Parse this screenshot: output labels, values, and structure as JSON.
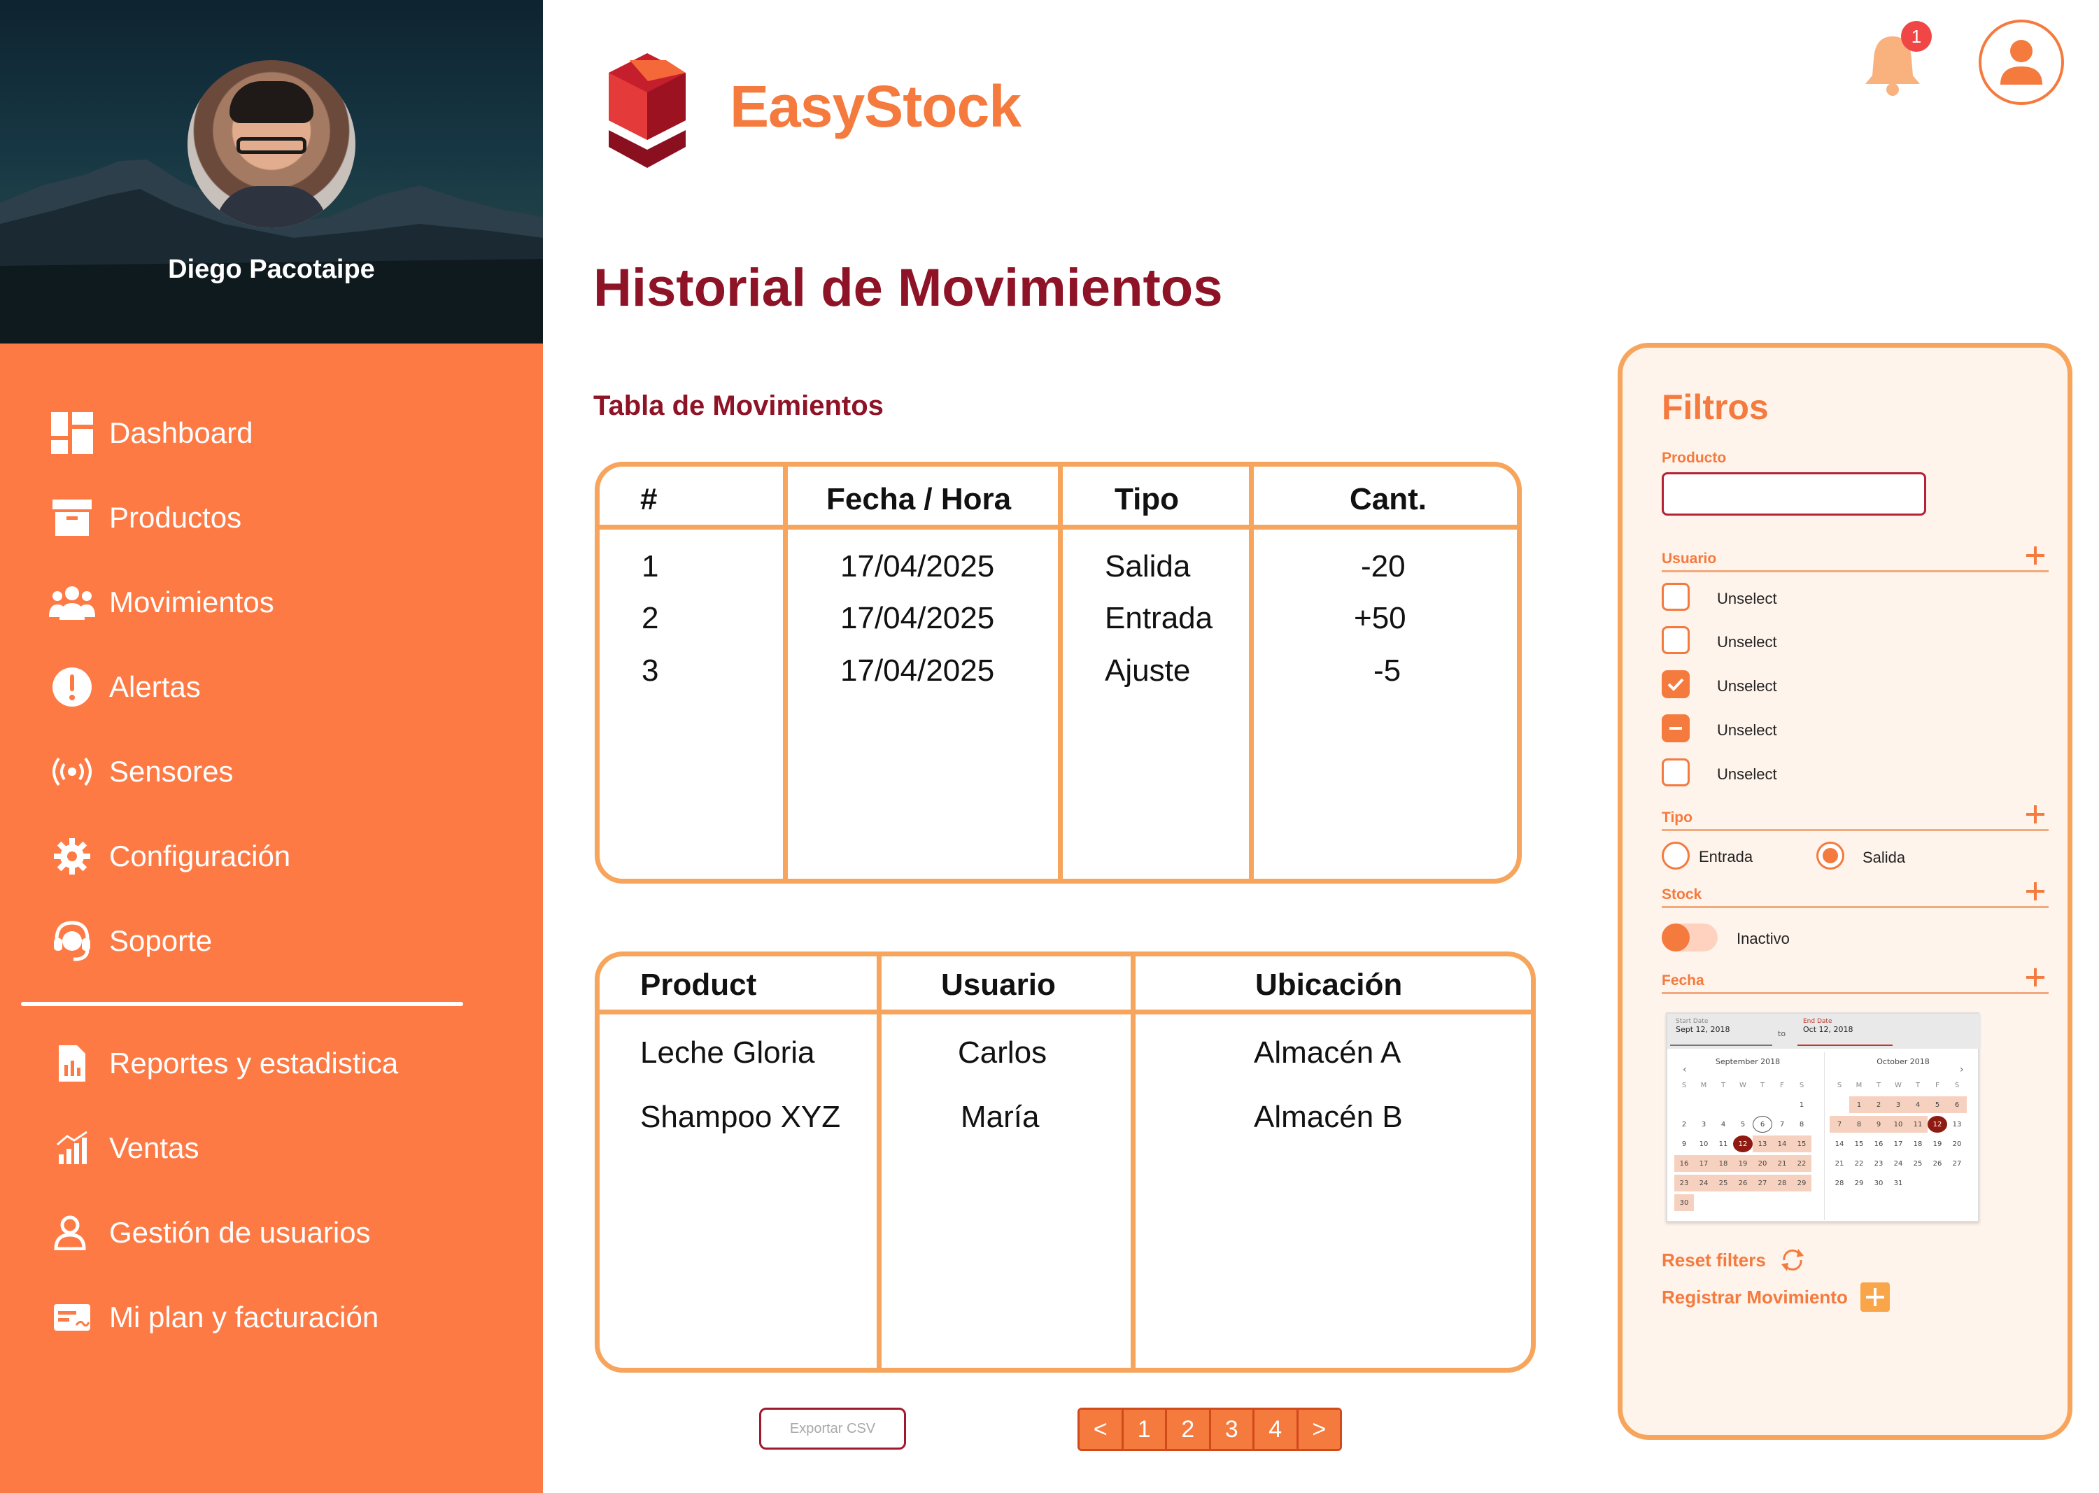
{
  "user": {
    "name": "Diego Pacotaipe"
  },
  "brand": {
    "name": "EasyStock"
  },
  "notifications": {
    "count": "1"
  },
  "nav": {
    "primary": [
      {
        "label": "Dashboard",
        "icon": "dashboard-icon"
      },
      {
        "label": "Productos",
        "icon": "archive-box-icon"
      },
      {
        "label": "Movimientos",
        "icon": "users-group-icon"
      },
      {
        "label": "Alertas",
        "icon": "alert-icon"
      },
      {
        "label": "Sensores",
        "icon": "sensor-signal-icon"
      },
      {
        "label": "Configuración",
        "icon": "gear-icon"
      },
      {
        "label": "Soporte",
        "icon": "support-headset-icon"
      }
    ],
    "secondary": [
      {
        "label": "Reportes y estadistica",
        "icon": "report-icon"
      },
      {
        "label": "Ventas",
        "icon": "sales-chart-icon"
      },
      {
        "label": "Gestión de usuarios",
        "icon": "user-manage-icon"
      },
      {
        "label": "Mi plan y facturación",
        "icon": "billing-card-icon"
      }
    ]
  },
  "page": {
    "title": "Historial de Movimientos",
    "section_title": "Tabla de Movimientos"
  },
  "table_movements": {
    "headers": [
      "#",
      "Fecha / Hora",
      "Tipo",
      "Cant."
    ],
    "rows": [
      [
        "1",
        "17/04/2025",
        "Salida",
        "-20"
      ],
      [
        "2",
        "17/04/2025",
        "Entrada",
        "+50"
      ],
      [
        "3",
        "17/04/2025",
        "Ajuste",
        "-5"
      ]
    ]
  },
  "table_details": {
    "headers": [
      "Product",
      "Usuario",
      "Ubicación"
    ],
    "rows": [
      [
        "Leche Gloria",
        "Carlos",
        "Almacén A"
      ],
      [
        "Shampoo XYZ",
        "María",
        "Almacén B"
      ]
    ]
  },
  "controls": {
    "export_label": "Exportar CSV",
    "pages": [
      "1",
      "2",
      "3",
      "4"
    ],
    "prev": "<",
    "next": ">"
  },
  "filters": {
    "title": "Filtros",
    "product_label": "Producto",
    "product_value": "",
    "usuario_label": "Usuario",
    "usuario_options": [
      {
        "label": "Unselect",
        "state": "unchecked"
      },
      {
        "label": "Unselect",
        "state": "unchecked"
      },
      {
        "label": "Unselect",
        "state": "checked"
      },
      {
        "label": "Unselect",
        "state": "indeterminate"
      },
      {
        "label": "Unselect",
        "state": "unchecked"
      }
    ],
    "tipo_label": "Tipo",
    "tipo_options": [
      {
        "label": "Entrada",
        "selected": false
      },
      {
        "label": "Salida",
        "selected": true
      }
    ],
    "stock_label": "Stock",
    "stock_toggle_label": "Inactivo",
    "fecha_label": "Fecha",
    "date_picker": {
      "start_label": "Start Date",
      "start_value": "Sept 12, 2018",
      "to": "to",
      "end_label": "End Date",
      "end_value": "Oct 12, 2018",
      "month1": "September 2018",
      "month2": "October 2018",
      "dow": [
        "S",
        "M",
        "T",
        "W",
        "T",
        "F",
        "S"
      ]
    },
    "reset_label": "Reset filters",
    "register_label": "Registrar Movimiento"
  },
  "colors": {
    "accent": "#f47a3e",
    "sidebar": "#fe7a45",
    "title": "#8e1326",
    "border": "#f7a55c"
  }
}
